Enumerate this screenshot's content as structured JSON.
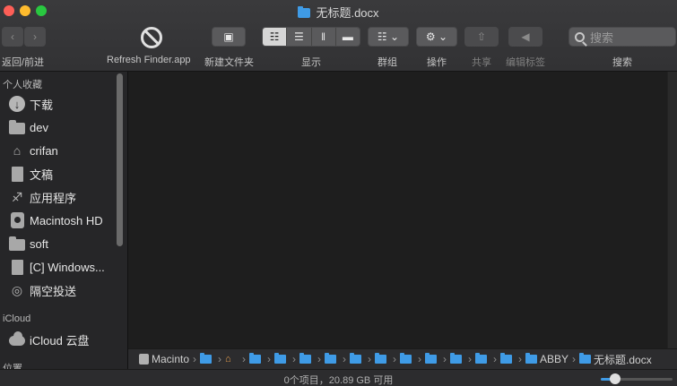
{
  "window": {
    "title": "无标题.docx"
  },
  "toolbar": {
    "nav_label": "返回/前进",
    "refresh_label": "Refresh Finder.app",
    "new_folder_label": "新建文件夹",
    "view_label": "显示",
    "group_label": "群组",
    "action_label": "操作",
    "share_label": "共享",
    "tags_label": "编辑标签",
    "search_label": "搜索",
    "search_placeholder": "搜索",
    "active_view": "icon"
  },
  "sidebar": {
    "favorites_heading": "个人收藏",
    "favorites": [
      {
        "label": "下载",
        "icon": "download-icon"
      },
      {
        "label": "dev",
        "icon": "folder-icon"
      },
      {
        "label": "crifan",
        "icon": "home-icon"
      },
      {
        "label": "文稿",
        "icon": "documents-icon"
      },
      {
        "label": "应用程序",
        "icon": "applications-icon"
      },
      {
        "label": "Macintosh HD",
        "icon": "hard-disk-icon"
      },
      {
        "label": "soft",
        "icon": "folder-icon"
      },
      {
        "label": "[C] Windows...",
        "icon": "document-icon"
      },
      {
        "label": "隔空投送",
        "icon": "airdrop-icon"
      }
    ],
    "icloud_heading": "iCloud",
    "icloud": [
      {
        "label": "iCloud 云盘",
        "icon": "cloud-icon"
      }
    ],
    "locations_heading": "位置"
  },
  "pathbar": {
    "crumbs": [
      {
        "label": "Macintosh HD",
        "icon": "hard-disk-icon"
      },
      {
        "label": "",
        "icon": "folder-icon"
      },
      {
        "label": "",
        "icon": "home-icon"
      },
      {
        "label": "",
        "icon": "folder-icon"
      },
      {
        "label": "",
        "icon": "folder-icon"
      },
      {
        "label": "",
        "icon": "folder-icon"
      },
      {
        "label": "",
        "icon": "folder-icon"
      },
      {
        "label": "",
        "icon": "folder-icon"
      },
      {
        "label": "",
        "icon": "folder-icon"
      },
      {
        "label": "",
        "icon": "folder-icon"
      },
      {
        "label": "",
        "icon": "folder-icon"
      },
      {
        "label": "",
        "icon": "folder-icon"
      },
      {
        "label": "",
        "icon": "folder-icon"
      },
      {
        "label": "",
        "icon": "folder-icon"
      },
      {
        "label": "ABBY",
        "icon": "folder-icon"
      },
      {
        "label": "无标题.docx",
        "icon": "folder-icon"
      }
    ]
  },
  "status": {
    "text": "0个项目，20.89 GB 可用",
    "zoom": 0.2
  },
  "colors": {
    "accent": "#3f9be6",
    "close": "#fe5f57",
    "minimize": "#febb2e",
    "zoom": "#29c840"
  }
}
